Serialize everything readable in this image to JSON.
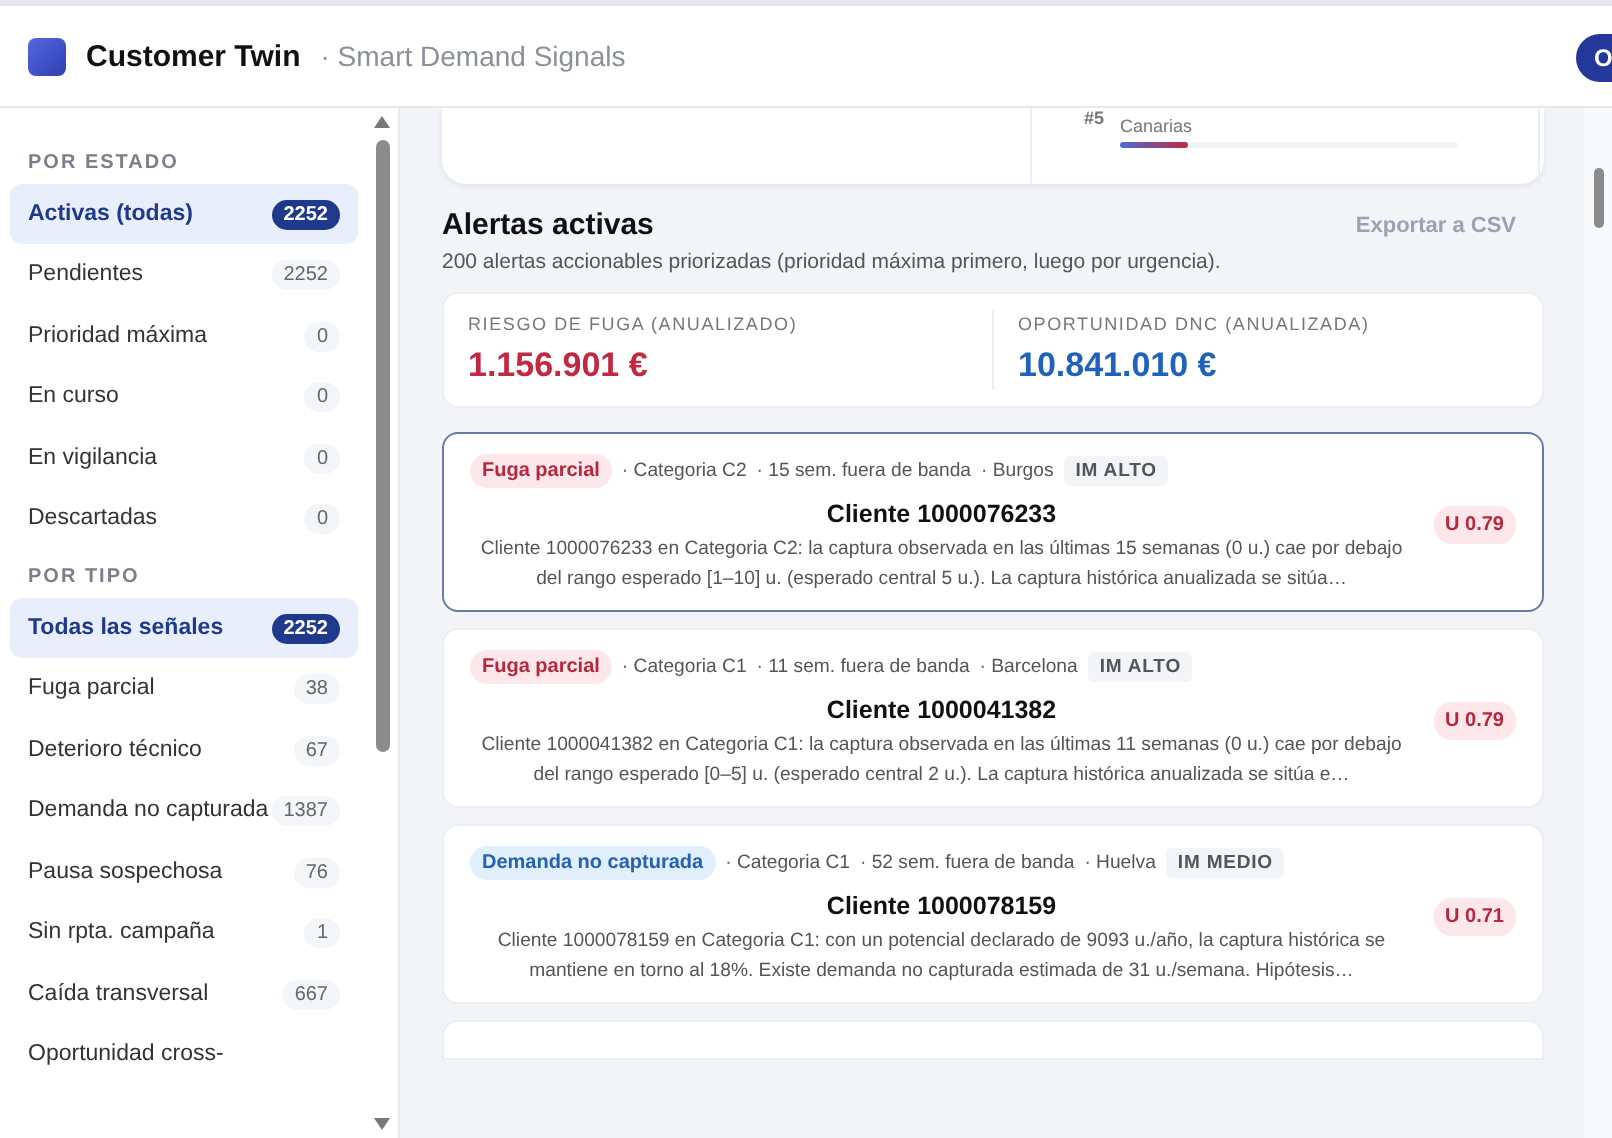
{
  "header": {
    "title": "Customer Twin",
    "subtitle": "· Smart Demand Signals",
    "action": "O"
  },
  "sidebar": {
    "sections": [
      {
        "heading": "POR ESTADO",
        "items": [
          {
            "label": "Activas (todas)",
            "count": "2252",
            "selected": true
          },
          {
            "label": "Pendientes",
            "count": "2252",
            "selected": false
          },
          {
            "label": "Prioridad máxima",
            "count": "0",
            "selected": false
          },
          {
            "label": "En curso",
            "count": "0",
            "selected": false
          },
          {
            "label": "En vigilancia",
            "count": "0",
            "selected": false
          },
          {
            "label": "Descartadas",
            "count": "0",
            "selected": false
          }
        ]
      },
      {
        "heading": "POR TIPO",
        "items": [
          {
            "label": "Todas las señales",
            "count": "2252",
            "selected": true
          },
          {
            "label": "Fuga parcial",
            "count": "38",
            "selected": false
          },
          {
            "label": "Deterioro técnico",
            "count": "67",
            "selected": false
          },
          {
            "label": "Demanda no capturada",
            "count": "1387",
            "selected": false
          },
          {
            "label": "Pausa sospechosa",
            "count": "76",
            "selected": false
          },
          {
            "label": "Sin rpta. campaña",
            "count": "1",
            "selected": false
          },
          {
            "label": "Caída transversal",
            "count": "667",
            "selected": false
          },
          {
            "label": "Oportunidad cross-",
            "selected": false
          }
        ]
      }
    ]
  },
  "ranking": {
    "rank": "#5",
    "region": "Canarias",
    "level": 0.2
  },
  "alerts_section": {
    "title": "Alertas activas",
    "export": "Exportar a CSV",
    "description": "200 alertas accionables priorizadas (prioridad máxima primero, luego por urgencia).",
    "kpis": [
      {
        "label": "RIESGO DE FUGA (ANUALIZADO)",
        "value": "1.156.901 €",
        "kind": "risk"
      },
      {
        "label": "OPORTUNIDAD DNC (ANUALIZADA)",
        "value": "10.841.010 €",
        "kind": "opportunity"
      }
    ],
    "alerts": [
      {
        "type": "Fuga parcial",
        "kind": "churn",
        "category": "· Categoria C2",
        "weeks": "· 15 sem. fuera de banda",
        "city": "· Burgos",
        "impact": "IM ALTO",
        "title": "Cliente 1000076233",
        "urgency": "U 0.79",
        "selected": true,
        "text": "Cliente 1000076233 en Categoria C2: la captura observada en las últimas 15 semanas (0 u.) cae por debajo del rango esperado [1–10] u. (esperado central 5 u.). La captura histórica anualizada se sitúa…"
      },
      {
        "type": "Fuga parcial",
        "kind": "churn",
        "category": "· Categoria C1",
        "weeks": "· 11 sem. fuera de banda",
        "city": "· Barcelona",
        "impact": "IM ALTO",
        "title": "Cliente 1000041382",
        "urgency": "U 0.79",
        "selected": false,
        "text": "Cliente 1000041382 en Categoria C1: la captura observada en las últimas 11 semanas (0 u.) cae por debajo del rango esperado [0–5] u. (esperado central 2 u.). La captura histórica anualizada se sitúa e…"
      },
      {
        "type": "Demanda no capturada",
        "kind": "demand",
        "category": "· Categoria C1",
        "weeks": "· 52 sem. fuera de banda",
        "city": "· Huelva",
        "impact": "IM MEDIO",
        "title": "Cliente 1000078159",
        "urgency": "U 0.71",
        "selected": false,
        "text": "Cliente 1000078159 en Categoria C1: con un potencial declarado de 9093 u./año, la captura histórica se mantiene en torno al 18%. Existe demanda no capturada estimada de 31 u./semana. Hipótesis…"
      }
    ]
  }
}
